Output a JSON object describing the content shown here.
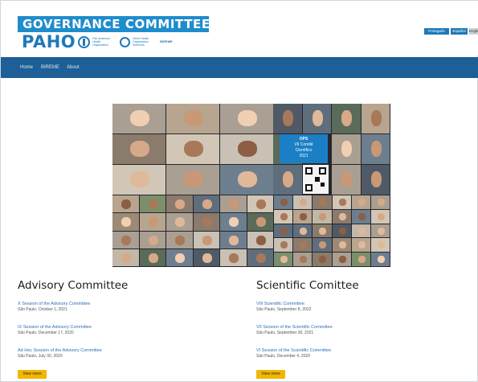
{
  "header": {
    "title": "GOVERNANCE COMMITTEES",
    "brand": "PAHO",
    "org_lines": [
      "Pan American",
      "Health",
      "Organization"
    ],
    "who_lines": [
      "World Health",
      "Organization",
      "Americas"
    ],
    "bireme_label": "BIREME",
    "languages": [
      "Português",
      "Español",
      "English"
    ]
  },
  "nav": {
    "items": [
      "Home",
      "BIREME",
      "About"
    ]
  },
  "collage": {
    "caption_lines": [
      "OPS",
      "VII Comitê",
      "Científico",
      "2021"
    ]
  },
  "advisory": {
    "title": "Advisory Committee",
    "entries": [
      {
        "link": "X Session of the Advisory Committee",
        "meta": "São Paulo, October 1, 2021"
      },
      {
        "link": "IX Session of the Advisory Committee",
        "meta": "São Paulo, December 17, 2020"
      },
      {
        "link": "Ad Hoc Session of the Advisory Committee",
        "meta": "São Paulo, July 30, 2020"
      }
    ],
    "more_label": "View more"
  },
  "scientific": {
    "title": "Scientific Comittee",
    "entries": [
      {
        "link": "VIII Scientific Committee",
        "meta": "São Paulo, September 8, 2022"
      },
      {
        "link": "VII Session of the Scientific Committee",
        "meta": "São Paulo, September 30, 2021"
      },
      {
        "link": "VI Session of the Scientific Committee",
        "meta": "São Paulo, December 4, 2020"
      }
    ],
    "more_label": "View more"
  },
  "colors": {
    "accent_blue": "#1f8ccc",
    "nav_blue": "#1d5f96",
    "link_blue": "#2b6fb6",
    "button_yellow": "#f2b705"
  }
}
